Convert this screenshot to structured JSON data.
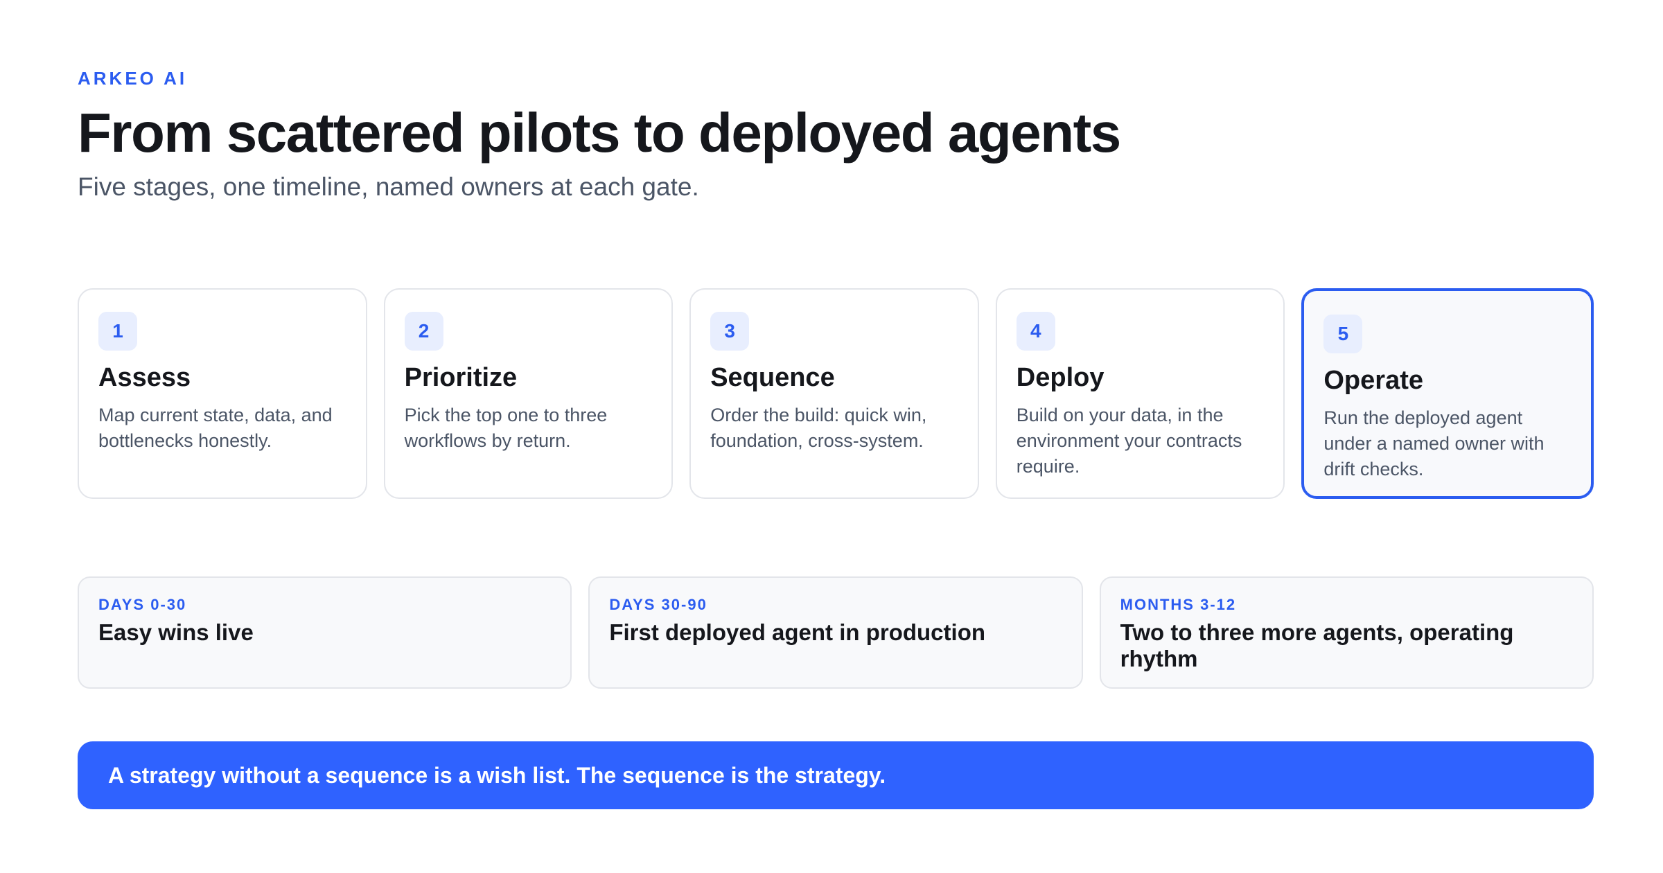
{
  "brand": "ARKEO AI",
  "title": "From scattered pilots to deployed agents",
  "subtitle": "Five stages, one timeline, named owners at each gate.",
  "steps": [
    {
      "number": "1",
      "title": "Assess",
      "description": "Map current state, data, and bottlenecks honestly."
    },
    {
      "number": "2",
      "title": "Prioritize",
      "description": "Pick the top one to three workflows by return."
    },
    {
      "number": "3",
      "title": "Sequence",
      "description": "Order the build: quick win, foundation, cross-system."
    },
    {
      "number": "4",
      "title": "Deploy",
      "description": "Build on your data, in the environment your contracts require."
    },
    {
      "number": "5",
      "title": "Operate",
      "description": "Run the deployed agent under a named owner with drift checks."
    }
  ],
  "phases": [
    {
      "tag": "DAYS 0-30",
      "title": "Easy wins live"
    },
    {
      "tag": "DAYS 30-90",
      "title": "First deployed agent in production"
    },
    {
      "tag": "MONTHS 3-12",
      "title": "Two to three more agents, operating rhythm"
    }
  ],
  "banner": "A strategy without a sequence is a wish list. The sequence is the strategy.",
  "colors": {
    "accent": "#2b5cf0",
    "banner": "#2f62ff",
    "active_border": "#2b5cf0"
  }
}
